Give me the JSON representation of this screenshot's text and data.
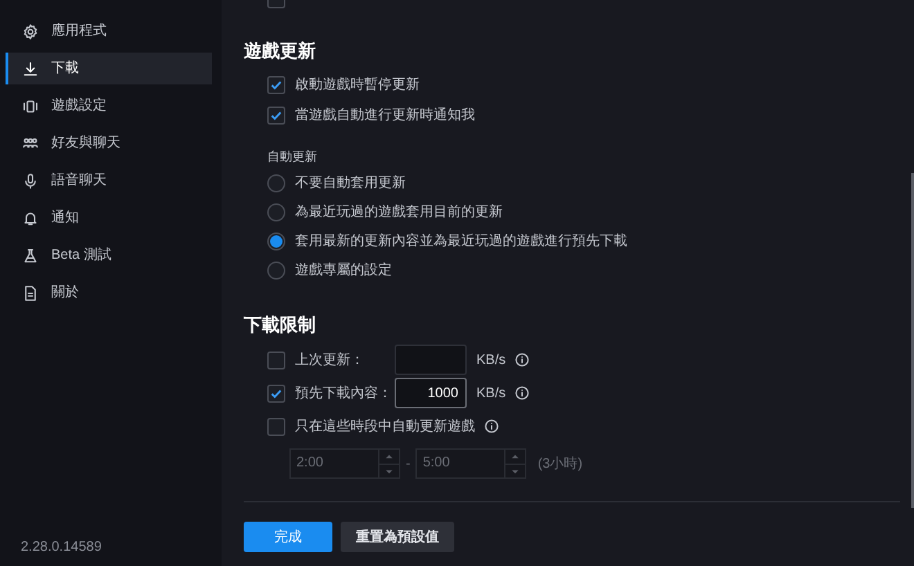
{
  "sidebar": {
    "items": [
      {
        "label": "應用程式",
        "selected": false
      },
      {
        "label": "下載",
        "selected": true
      },
      {
        "label": "遊戲設定",
        "selected": false
      },
      {
        "label": "好友與聊天",
        "selected": false
      },
      {
        "label": "語音聊天",
        "selected": false
      },
      {
        "label": "通知",
        "selected": false
      },
      {
        "label": "Beta 測試",
        "selected": false
      },
      {
        "label": "關於",
        "selected": false
      }
    ],
    "version": "2.28.0.14589"
  },
  "top_checkbox": {
    "checked": false
  },
  "game_updates": {
    "title": "遊戲更新",
    "checkboxes": [
      {
        "label": "啟動遊戲時暫停更新",
        "checked": true
      },
      {
        "label": "當遊戲自動進行更新時通知我",
        "checked": true
      }
    ],
    "auto_update": {
      "label": "自動更新",
      "options": [
        {
          "label": "不要自動套用更新",
          "selected": false
        },
        {
          "label": "為最近玩過的遊戲套用目前的更新",
          "selected": false
        },
        {
          "label": "套用最新的更新內容並為最近玩過的遊戲進行預先下載",
          "selected": true
        },
        {
          "label": "遊戲專屬的設定",
          "selected": false
        }
      ]
    }
  },
  "download_limits": {
    "title": "下載限制",
    "rows": [
      {
        "kind": "rate",
        "label": "上次更新：",
        "checked": false,
        "value": "",
        "unit": "KB/s"
      },
      {
        "kind": "rate",
        "label": "預先下載內容：",
        "checked": true,
        "value": "1000",
        "unit": "KB/s"
      },
      {
        "kind": "schedule",
        "label": "只在這些時段中自動更新遊戲",
        "checked": false
      }
    ],
    "time_range": {
      "start": "2:00",
      "separator": "-",
      "end": "5:00",
      "duration": "(3小時)"
    }
  },
  "buttons": {
    "done": "完成",
    "reset": "重置為預設值"
  }
}
